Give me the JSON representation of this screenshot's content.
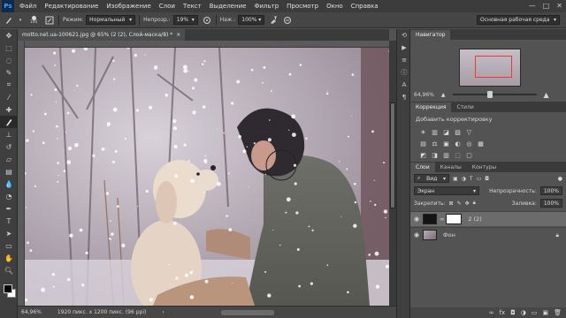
{
  "app": {
    "logo": "Ps"
  },
  "menu": [
    "Файл",
    "Редактирование",
    "Изображение",
    "Слои",
    "Текст",
    "Выделение",
    "Фильтр",
    "Просмотр",
    "Окно",
    "Справка"
  ],
  "window_controls": [
    "—",
    "□",
    "✕"
  ],
  "options": {
    "brush_size": "100",
    "mode_label": "Режим:",
    "mode_value": "Нормальный",
    "opacity_label": "Непрозр.:",
    "opacity_value": "19%",
    "flow_label": "Наж.:",
    "flow_value": "100%",
    "workspace": "Основная рабочая среда"
  },
  "document": {
    "tab_title": "motto.net.ua-100621.jpg @ 65% (2 (2), Слой-маска/8) *",
    "close": "×"
  },
  "status": {
    "zoom": "64,96%",
    "doc_size": "1920 пикс. x 1200 пикс. (96 ppi)"
  },
  "navigator": {
    "tab": "Навигатор",
    "zoom": "64,96%",
    "zoom_fraction": 0.45
  },
  "adjustments": {
    "tabs": [
      "Коррекция",
      "Стили"
    ],
    "title": "Добавить корректировку",
    "row1": [
      "☀",
      "▥",
      "◪",
      "▧",
      "▽"
    ],
    "row2": [
      "▤",
      "⚖",
      "▣",
      "◐",
      "◎",
      "▦"
    ],
    "row3": [
      "◩",
      "◨",
      "▥",
      "⬚",
      "▢"
    ]
  },
  "layers": {
    "tabs": [
      "Слои",
      "Каналы",
      "Контуры"
    ],
    "filter_label": "Вид",
    "blend_mode": "Экран",
    "opacity_label": "Непрозрачность:",
    "opacity_value": "100%",
    "lock_label": "Закрепить:",
    "fill_label": "Заливка:",
    "fill_value": "100%",
    "items": [
      {
        "name": "2 (2)",
        "selected": true
      },
      {
        "name": "Фон",
        "selected": false
      }
    ],
    "footer_icons": [
      "∞",
      "fx",
      "◘",
      "◑",
      "▭",
      "▣",
      "🗑"
    ]
  },
  "colors": {
    "accent": "#31a8ff",
    "navigator_frame": "#e83c3c"
  }
}
